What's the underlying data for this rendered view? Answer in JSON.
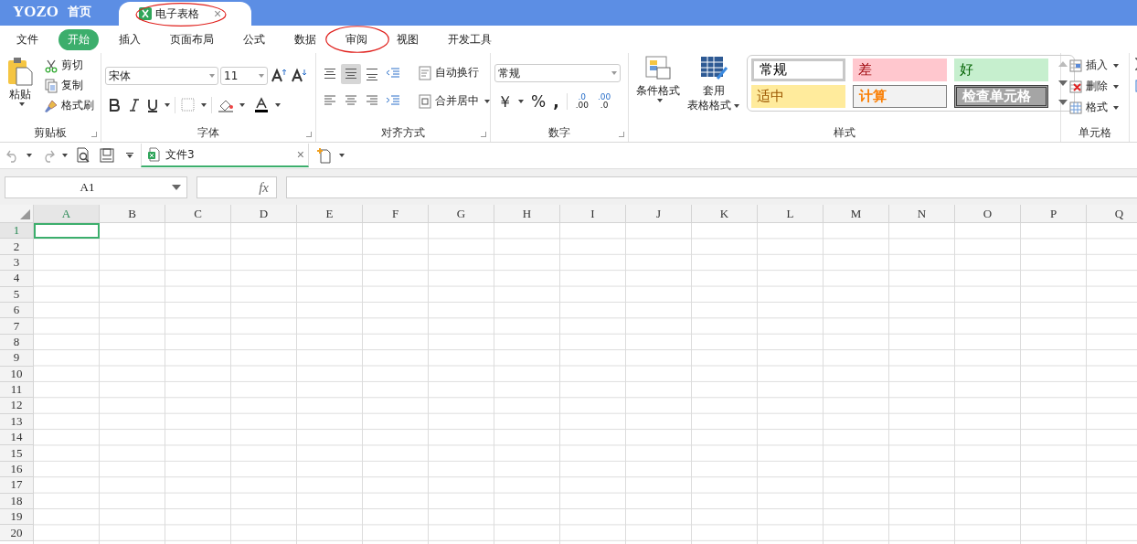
{
  "app": {
    "logo": "YOZO",
    "home": "首页"
  },
  "doc_tab": {
    "title": "电子表格",
    "close": "×",
    "circled": true
  },
  "menu_tabs": [
    {
      "label": "文件",
      "selected": false,
      "circled": false
    },
    {
      "label": "开始",
      "selected": true,
      "circled": false
    },
    {
      "label": "插入",
      "selected": false,
      "circled": false
    },
    {
      "label": "页面布局",
      "selected": false,
      "circled": false
    },
    {
      "label": "公式",
      "selected": false,
      "circled": false
    },
    {
      "label": "数据",
      "selected": false,
      "circled": false
    },
    {
      "label": "审阅",
      "selected": false,
      "circled": true
    },
    {
      "label": "视图",
      "selected": false,
      "circled": false
    },
    {
      "label": "开发工具",
      "selected": false,
      "circled": false
    }
  ],
  "ribbon": {
    "clipboard": {
      "paste": "粘贴",
      "items": [
        {
          "kind": "cut",
          "label": "剪切"
        },
        {
          "kind": "copy",
          "label": "复制"
        },
        {
          "kind": "brush",
          "label": "格式刷"
        }
      ],
      "label": "剪贴板"
    },
    "font": {
      "name": "宋体",
      "size": "11",
      "label": "字体"
    },
    "alignment": {
      "buttons": [
        {
          "kind": "top",
          "on": false
        },
        {
          "kind": "middle",
          "on": true
        },
        {
          "kind": "bottom",
          "on": false
        },
        {
          "kind": "outdent",
          "on": false
        },
        {
          "kind": "left",
          "on": false
        },
        {
          "kind": "center",
          "on": false
        },
        {
          "kind": "right",
          "on": false
        },
        {
          "kind": "indent",
          "on": false
        }
      ],
      "wrap": "自动换行",
      "merge": "合并居中",
      "label": "对齐方式"
    },
    "number": {
      "format": "常规",
      "currency": "￥",
      "percent": "%",
      "comma": ",",
      "decimals": [
        {
          "top": ".0",
          "bottom": ".00"
        },
        {
          "top": ".00",
          "bottom": ".0"
        }
      ],
      "label": "数字"
    },
    "styles": {
      "conditional": "条件格式",
      "table_format": [
        "套用",
        "表格格式"
      ],
      "cells": [
        {
          "label": "常规",
          "kind": "normal"
        },
        {
          "label": "差",
          "kind": "bad"
        },
        {
          "label": "好",
          "kind": "good"
        },
        {
          "label": "适中",
          "kind": "neutral"
        },
        {
          "label": "计算",
          "kind": "calc"
        },
        {
          "label": "检查单元格",
          "kind": "check"
        }
      ],
      "label": "样式"
    },
    "cells": {
      "items": [
        {
          "kind": "insert",
          "label": "插入"
        },
        {
          "kind": "delete",
          "label": "删除"
        },
        {
          "kind": "format",
          "label": "格式"
        }
      ],
      "label": "单元格"
    }
  },
  "quick_bar": {
    "file_tab": "文件3",
    "close": "×"
  },
  "formula_bar": {
    "name_box": "A1",
    "fx": "fx"
  },
  "sheet": {
    "columns": [
      {
        "label": "A",
        "selected": true
      },
      {
        "label": "B",
        "selected": false
      },
      {
        "label": "C",
        "selected": false
      },
      {
        "label": "D",
        "selected": false
      },
      {
        "label": "E",
        "selected": false
      },
      {
        "label": "F",
        "selected": false
      },
      {
        "label": "G",
        "selected": false
      },
      {
        "label": "H",
        "selected": false
      },
      {
        "label": "I",
        "selected": false
      },
      {
        "label": "J",
        "selected": false
      },
      {
        "label": "K",
        "selected": false
      },
      {
        "label": "L",
        "selected": false
      },
      {
        "label": "M",
        "selected": false
      },
      {
        "label": "N",
        "selected": false
      },
      {
        "label": "O",
        "selected": false
      },
      {
        "label": "P",
        "selected": false
      },
      {
        "label": "Q",
        "selected": false
      }
    ],
    "rows": [
      {
        "label": "1",
        "selected": true
      },
      {
        "label": "2",
        "selected": false
      },
      {
        "label": "3",
        "selected": false
      },
      {
        "label": "4",
        "selected": false
      },
      {
        "label": "5",
        "selected": false
      },
      {
        "label": "6",
        "selected": false
      },
      {
        "label": "7",
        "selected": false
      },
      {
        "label": "8",
        "selected": false
      },
      {
        "label": "9",
        "selected": false
      },
      {
        "label": "10",
        "selected": false
      },
      {
        "label": "11",
        "selected": false
      },
      {
        "label": "12",
        "selected": false
      },
      {
        "label": "13",
        "selected": false
      },
      {
        "label": "14",
        "selected": false
      },
      {
        "label": "15",
        "selected": false
      },
      {
        "label": "16",
        "selected": false
      },
      {
        "label": "17",
        "selected": false
      },
      {
        "label": "18",
        "selected": false
      },
      {
        "label": "19",
        "selected": false
      },
      {
        "label": "20",
        "selected": false
      }
    ]
  }
}
